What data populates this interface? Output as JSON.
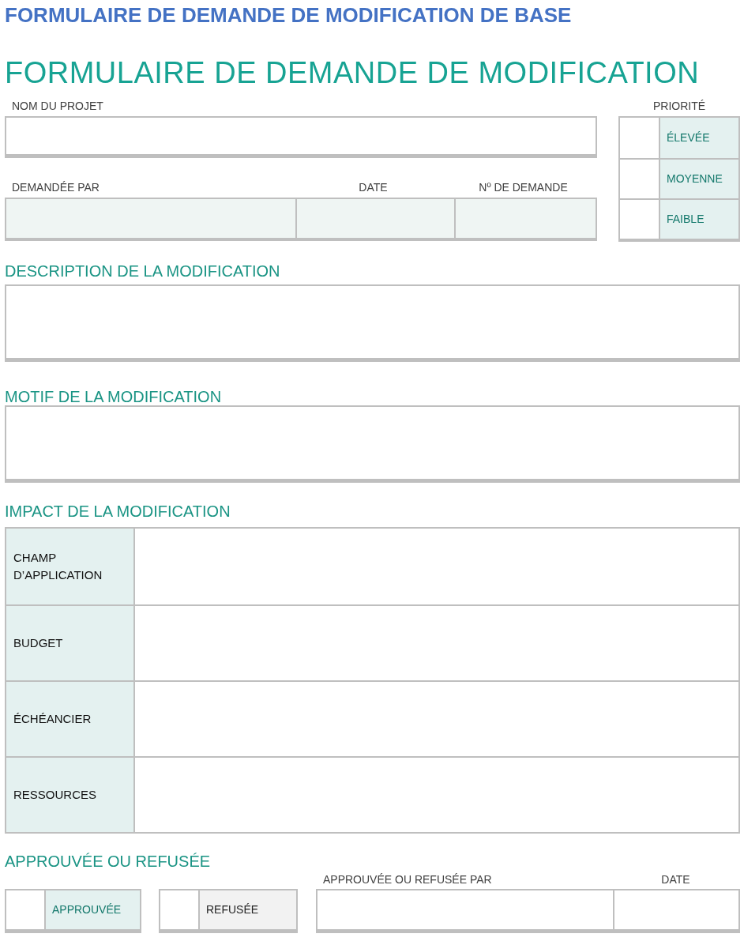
{
  "page_title": "FORMULAIRE DE DEMANDE DE MODIFICATION DE BASE",
  "form_title": "FORMULAIRE DE DEMANDE DE MODIFICATION",
  "project": {
    "label": "NOM DU PROJET"
  },
  "request_fields": [
    {
      "label": "DEMANDÉE PAR"
    },
    {
      "label": "DATE"
    },
    {
      "label": "Nº DE DEMANDE"
    }
  ],
  "priority": {
    "label": "PRIORITÉ",
    "options": [
      {
        "label": "ÉLEVÉE",
        "checked": false
      },
      {
        "label": "MOYENNE",
        "checked": false
      },
      {
        "label": "FAIBLE",
        "checked": false
      }
    ]
  },
  "description": {
    "heading": "DESCRIPTION DE LA MODIFICATION"
  },
  "reason": {
    "heading": "MOTIF DE LA MODIFICATION"
  },
  "impact": {
    "heading": "IMPACT DE LA MODIFICATION",
    "rows": [
      {
        "label": "CHAMP\nD’APPLICATION"
      },
      {
        "label": "BUDGET"
      },
      {
        "label": "ÉCHÉANCIER"
      },
      {
        "label": "RESSOURCES"
      }
    ]
  },
  "approval": {
    "heading": "APPROUVÉE OU REFUSÉE",
    "options": [
      {
        "label": "APPROUVÉE",
        "kind": "approved",
        "checked": false
      },
      {
        "label": "REFUSÉE",
        "kind": "refused",
        "checked": false
      }
    ],
    "fields": [
      {
        "label": "APPROUVÉE OU REFUSÉE PAR"
      },
      {
        "label": "DATE"
      }
    ]
  }
}
